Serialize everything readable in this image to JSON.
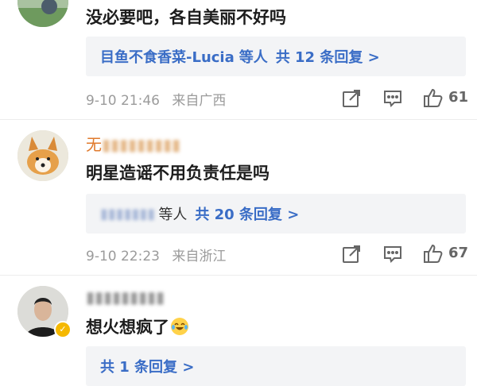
{
  "comments": [
    {
      "text": "没必要吧，各自美丽不好吗",
      "replies_who": "目鱼不食香菜-Lucia",
      "replies_suffix": "等人",
      "replies_count": "共 12 条回复 >",
      "time": "9-10 21:46",
      "location": "来自广西",
      "likes": "61"
    },
    {
      "user": "无",
      "text": "明星造谣不用负责任是吗",
      "replies_suffix": "等人",
      "replies_count": "共 20 条回复 >",
      "time": "9-10 22:23",
      "location": "来自浙江",
      "likes": "67"
    },
    {
      "text": "想火想疯了",
      "replies_count": "共 1 条回复 >"
    }
  ],
  "colors": {
    "link": "#3a6dc6",
    "username": "#e07a2c",
    "meta": "#9b9b9b"
  },
  "icons": [
    "share-icon",
    "comment-icon",
    "thumbs-up-icon",
    "verified-badge-icon",
    "laughing-crying-emoji"
  ]
}
